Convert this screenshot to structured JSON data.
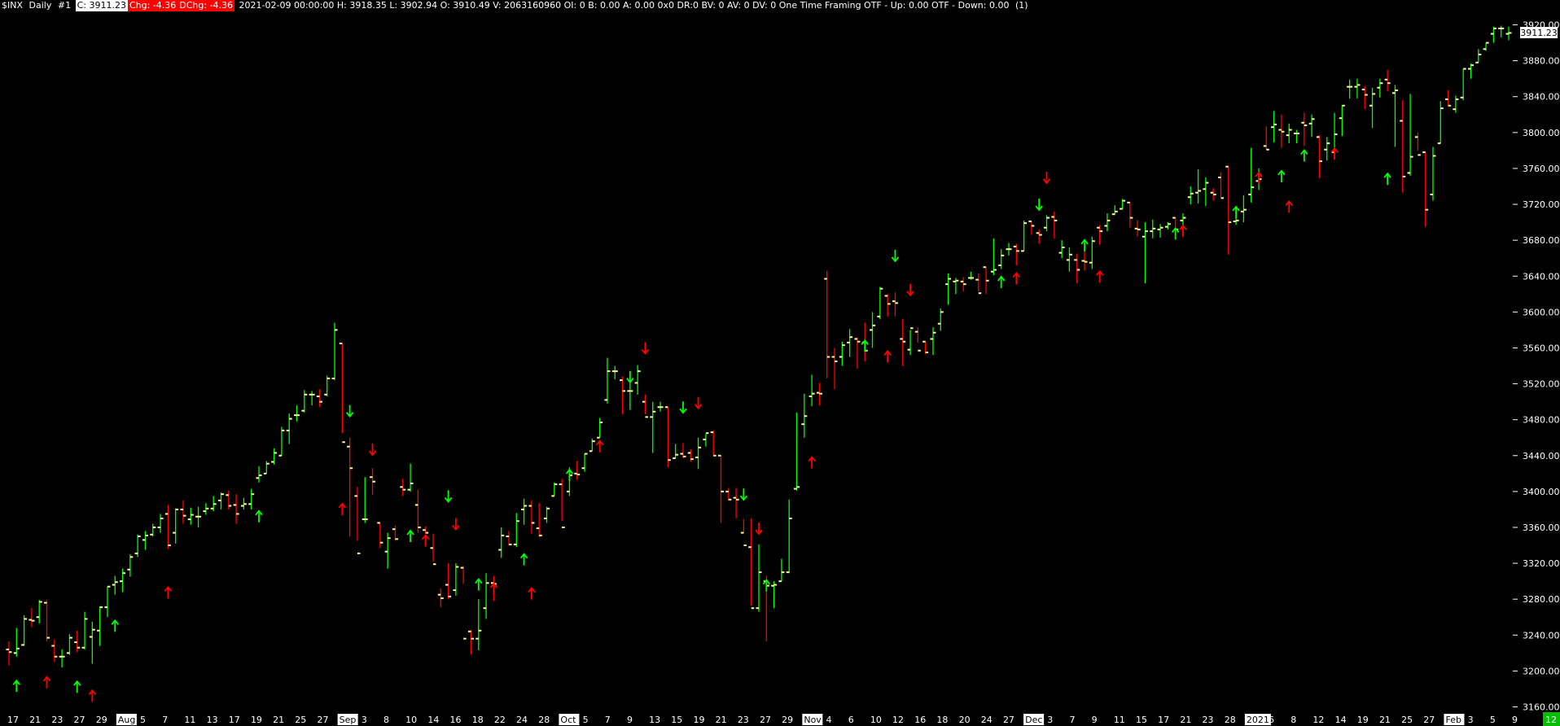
{
  "header": {
    "symbol": "$INX",
    "period": "Daily",
    "chart_no": "#1",
    "close": "C: 3911.23",
    "chg": "Chg: -4.36",
    "dchg": "DChg: -4.36",
    "ohlc": "2021-02-09 00:00:00 H: 3918.35 L: 3902.94 O: 3910.49 V: 2063160960 OI: 0 B: 0.00 A: 0.00 0x0 DR:0 BV: 0 AV: 0 DV: 0 One Time Framing  OTF - Up: 0.00  OTF - Down: 0.00",
    "count": "(1)"
  },
  "price_label": "3911.23",
  "corner_label": "12",
  "colors": {
    "up": "#00ff00",
    "down": "#ff0000",
    "oc_tick": "#ffff99",
    "background": "#000000",
    "text": "#ffffff"
  },
  "chart_data": {
    "type": "ohlc",
    "ylim": [
      3155,
      3935
    ],
    "y_ticks": [
      "3160.00",
      "3200.00",
      "3240.00",
      "3280.00",
      "3320.00",
      "3360.00",
      "3400.00",
      "3440.00",
      "3480.00",
      "3520.00",
      "3560.00",
      "3600.00",
      "3640.00",
      "3680.00",
      "3720.00",
      "3760.00",
      "3800.00",
      "3840.00",
      "3880.00",
      "3920.00"
    ],
    "x_ticks": [
      "17",
      "21",
      "23",
      "27",
      "29",
      "Aug",
      "5",
      "7",
      "11",
      "13",
      "17",
      "19",
      "21",
      "25",
      "27",
      "Sep",
      "3",
      "8",
      "10",
      "14",
      "16",
      "18",
      "22",
      "24",
      "28",
      "Oct",
      "5",
      "7",
      "9",
      "13",
      "15",
      "19",
      "21",
      "23",
      "27",
      "29",
      "Nov",
      "4",
      "6",
      "10",
      "12",
      "16",
      "18",
      "20",
      "24",
      "27",
      "Dec",
      "3",
      "7",
      "9",
      "11",
      "15",
      "17",
      "21",
      "23",
      "28",
      "2021",
      "6",
      "8",
      "12",
      "14",
      "19",
      "21",
      "25",
      "27",
      "Feb",
      "3",
      "5",
      "9"
    ],
    "boxed_x_ticks": [
      "Aug",
      "Sep",
      "Oct",
      "Nov",
      "Dec",
      "2021",
      "Feb"
    ],
    "bars": [
      [
        3224,
        3233,
        3206,
        3221
      ],
      [
        3220,
        3248,
        3216,
        3225
      ],
      [
        3229,
        3262,
        3228,
        3258
      ],
      [
        3257,
        3270,
        3249,
        3256
      ],
      [
        3260,
        3279,
        3253,
        3277
      ],
      [
        3276,
        3279,
        3233,
        3237
      ],
      [
        3228,
        3235,
        3210,
        3216
      ],
      [
        3216,
        3224,
        3204,
        3216
      ],
      [
        3220,
        3241,
        3218,
        3237
      ],
      [
        3232,
        3245,
        3221,
        3226
      ],
      [
        3226,
        3266,
        3224,
        3258
      ],
      [
        3238,
        3255,
        3208,
        3246
      ],
      [
        3245,
        3272,
        3228,
        3271
      ],
      [
        3271,
        3294,
        3260,
        3294
      ],
      [
        3296,
        3306,
        3285,
        3299
      ],
      [
        3300,
        3314,
        3288,
        3309
      ],
      [
        3313,
        3330,
        3305,
        3327
      ],
      [
        3331,
        3352,
        3327,
        3350
      ],
      [
        3346,
        3356,
        3335,
        3351
      ],
      [
        3352,
        3364,
        3350,
        3360
      ],
      [
        3360,
        3375,
        3354,
        3370
      ],
      [
        3375,
        3385,
        3336,
        3340
      ],
      [
        3354,
        3381,
        3342,
        3380
      ],
      [
        3380,
        3390,
        3364,
        3373
      ],
      [
        3369,
        3382,
        3363,
        3374
      ],
      [
        3372,
        3383,
        3360,
        3372
      ],
      [
        3378,
        3387,
        3374,
        3381
      ],
      [
        3381,
        3395,
        3378,
        3386
      ],
      [
        3390,
        3399,
        3380,
        3397
      ],
      [
        3396,
        3401,
        3380,
        3384
      ],
      [
        3385,
        3397,
        3364,
        3375
      ],
      [
        3384,
        3393,
        3380,
        3386
      ],
      [
        3386,
        3403,
        3380,
        3397
      ],
      [
        3415,
        3428,
        3410,
        3418
      ],
      [
        3420,
        3434,
        3420,
        3431
      ],
      [
        3433,
        3448,
        3430,
        3443
      ],
      [
        3440,
        3472,
        3440,
        3468
      ],
      [
        3468,
        3487,
        3453,
        3481
      ],
      [
        3485,
        3496,
        3478,
        3485
      ],
      [
        3490,
        3513,
        3488,
        3508
      ],
      [
        3508,
        3512,
        3496,
        3508
      ],
      [
        3506,
        3514,
        3494,
        3500
      ],
      [
        3508,
        3529,
        3506,
        3526
      ],
      [
        3526,
        3588,
        3524,
        3580
      ],
      [
        3565,
        3565,
        3465,
        3455
      ],
      [
        3450,
        3460,
        3350,
        3426
      ],
      [
        3395,
        3405,
        3345,
        3331
      ],
      [
        3369,
        3416,
        3365,
        3369
      ],
      [
        3416,
        3426,
        3396,
        3411
      ],
      [
        3365,
        3365,
        3337,
        3343
      ],
      [
        3333,
        3354,
        3314,
        3348
      ],
      [
        3358,
        3362,
        3345,
        3347
      ],
      [
        3405,
        3414,
        3395,
        3402
      ],
      [
        3402,
        3431,
        3400,
        3409
      ],
      [
        3385,
        3402,
        3354,
        3360
      ],
      [
        3357,
        3361,
        3353,
        3354
      ],
      [
        3337,
        3353,
        3322,
        3319
      ],
      [
        3285,
        3292,
        3271,
        3281
      ],
      [
        3296,
        3320,
        3280,
        3283
      ],
      [
        3290,
        3320,
        3284,
        3316
      ],
      [
        3315,
        3317,
        3297,
        3236
      ],
      [
        3244,
        3246,
        3218,
        3236
      ],
      [
        3236,
        3280,
        3223,
        3245
      ],
      [
        3270,
        3309,
        3258,
        3298
      ],
      [
        3298,
        3306,
        3278,
        3297
      ],
      [
        3335,
        3360,
        3326,
        3351
      ],
      [
        3350,
        3356,
        3340,
        3341
      ],
      [
        3341,
        3376,
        3338,
        3367
      ],
      [
        3380,
        3392,
        3363,
        3384
      ],
      [
        3384,
        3390,
        3353,
        3365
      ],
      [
        3359,
        3387,
        3349,
        3351
      ],
      [
        3370,
        3383,
        3365,
        3381
      ],
      [
        3395,
        3410,
        3395,
        3408
      ],
      [
        3408,
        3414,
        3367,
        3360
      ],
      [
        3400,
        3427,
        3395,
        3418
      ],
      [
        3420,
        3434,
        3413,
        3419
      ],
      [
        3426,
        3442,
        3422,
        3442
      ],
      [
        3445,
        3459,
        3445,
        3456
      ],
      [
        3460,
        3482,
        3460,
        3477
      ],
      [
        3502,
        3549,
        3498,
        3534
      ],
      [
        3534,
        3540,
        3525,
        3534
      ],
      [
        3524,
        3528,
        3486,
        3512
      ],
      [
        3512,
        3525,
        3491,
        3512
      ],
      [
        3521,
        3541,
        3508,
        3534
      ],
      [
        3500,
        3508,
        3486,
        3483
      ],
      [
        3483,
        3500,
        3443,
        3489
      ],
      [
        3494,
        3500,
        3489,
        3494
      ],
      [
        3494,
        3494,
        3427,
        3435
      ],
      [
        3437,
        3453,
        3437,
        3441
      ],
      [
        3442,
        3454,
        3437,
        3439
      ],
      [
        3443,
        3447,
        3433,
        3436
      ],
      [
        3438,
        3460,
        3425,
        3449
      ],
      [
        3458,
        3464,
        3450,
        3465
      ],
      [
        3466,
        3468,
        3440,
        3440
      ],
      [
        3440,
        3440,
        3365,
        3400
      ],
      [
        3400,
        3404,
        3390,
        3391
      ],
      [
        3393,
        3404,
        3370,
        3391
      ],
      [
        3354,
        3369,
        3354,
        3340
      ],
      [
        3338,
        3370,
        3273,
        3270
      ],
      [
        3270,
        3341,
        3266,
        3310
      ],
      [
        3300,
        3306,
        3233,
        3295
      ],
      [
        3295,
        3300,
        3270,
        3296
      ],
      [
        3300,
        3325,
        3300,
        3310
      ],
      [
        3310,
        3391,
        3309,
        3370
      ],
      [
        3403,
        3488,
        3401,
        3405
      ],
      [
        3475,
        3509,
        3460,
        3484
      ],
      [
        3506,
        3530,
        3495,
        3509
      ],
      [
        3510,
        3521,
        3496,
        3509
      ],
      [
        3637,
        3646,
        3526,
        3550
      ],
      [
        3550,
        3560,
        3514,
        3545
      ],
      [
        3550,
        3567,
        3540,
        3563
      ],
      [
        3566,
        3581,
        3550,
        3572
      ],
      [
        3570,
        3572,
        3537,
        3567
      ],
      [
        3566,
        3588,
        3545,
        3557
      ],
      [
        3580,
        3600,
        3560,
        3585
      ],
      [
        3595,
        3628,
        3592,
        3626
      ],
      [
        3618,
        3620,
        3595,
        3609
      ],
      [
        3612,
        3622,
        3595,
        3610
      ],
      [
        3570,
        3592,
        3540,
        3567
      ],
      [
        3558,
        3580,
        3552,
        3582
      ],
      [
        3578,
        3583,
        3566,
        3557
      ],
      [
        3567,
        3567,
        3553,
        3555
      ],
      [
        3570,
        3583,
        3552,
        3577
      ],
      [
        3587,
        3604,
        3579,
        3600
      ],
      [
        3631,
        3643,
        3608,
        3637
      ],
      [
        3634,
        3638,
        3620,
        3635
      ],
      [
        3634,
        3639,
        3623,
        3631
      ],
      [
        3638,
        3645,
        3636,
        3638
      ],
      [
        3636,
        3643,
        3623,
        3621
      ],
      [
        3650,
        3650,
        3620,
        3635
      ],
      [
        3645,
        3682,
        3641,
        3647
      ],
      [
        3652,
        3670,
        3648,
        3663
      ],
      [
        3670,
        3677,
        3663,
        3670
      ],
      [
        3673,
        3676,
        3652,
        3668
      ],
      [
        3668,
        3702,
        3668,
        3699
      ],
      [
        3701,
        3701,
        3686,
        3696
      ],
      [
        3688,
        3692,
        3676,
        3686
      ],
      [
        3694,
        3708,
        3690,
        3705
      ],
      [
        3706,
        3712,
        3682,
        3702
      ],
      [
        3666,
        3680,
        3660,
        3672
      ],
      [
        3658,
        3672,
        3645,
        3664
      ],
      [
        3658,
        3665,
        3632,
        3647
      ],
      [
        3657,
        3669,
        3646,
        3656
      ],
      [
        3655,
        3684,
        3648,
        3679
      ],
      [
        3694,
        3697,
        3675,
        3690
      ],
      [
        3696,
        3710,
        3690,
        3702
      ],
      [
        3709,
        3719,
        3708,
        3712
      ],
      [
        3715,
        3726,
        3714,
        3724
      ],
      [
        3722,
        3722,
        3694,
        3705
      ],
      [
        3693,
        3702,
        3684,
        3692
      ],
      [
        3684,
        3700,
        3632,
        3690
      ],
      [
        3690,
        3703,
        3682,
        3693
      ],
      [
        3692,
        3698,
        3683,
        3694
      ],
      [
        3695,
        3700,
        3692,
        3698
      ],
      [
        3705,
        3705,
        3694,
        3692
      ],
      [
        3702,
        3710,
        3691,
        3705
      ],
      [
        3728,
        3740,
        3720,
        3732
      ],
      [
        3733,
        3759,
        3721,
        3735
      ],
      [
        3737,
        3750,
        3718,
        3744
      ],
      [
        3733,
        3738,
        3724,
        3731
      ],
      [
        3750,
        3756,
        3728,
        3727
      ],
      [
        3762,
        3762,
        3664,
        3700
      ],
      [
        3701,
        3707,
        3697,
        3702
      ],
      [
        3712,
        3730,
        3700,
        3714
      ],
      [
        3731,
        3783,
        3722,
        3739
      ],
      [
        3746,
        3760,
        3736,
        3748
      ],
      [
        3785,
        3807,
        3781,
        3781
      ],
      [
        3806,
        3824,
        3789,
        3809
      ],
      [
        3803,
        3820,
        3783,
        3801
      ],
      [
        3797,
        3810,
        3788,
        3803
      ],
      [
        3799,
        3803,
        3788,
        3799
      ],
      [
        3811,
        3822,
        3785,
        3808
      ],
      [
        3810,
        3820,
        3795,
        3815
      ],
      [
        3795,
        3797,
        3749,
        3768
      ],
      [
        3781,
        3795,
        3769,
        3788
      ],
      [
        3778,
        3822,
        3770,
        3798
      ],
      [
        3816,
        3830,
        3796,
        3830
      ],
      [
        3851,
        3859,
        3838,
        3851
      ],
      [
        3851,
        3860,
        3838,
        3853
      ],
      [
        3848,
        3852,
        3826,
        3842
      ],
      [
        3830,
        3850,
        3805,
        3843
      ],
      [
        3850,
        3860,
        3839,
        3855
      ],
      [
        3859,
        3870,
        3846,
        3855
      ],
      [
        3844,
        3853,
        3784,
        3847
      ],
      [
        3813,
        3836,
        3733,
        3751
      ],
      [
        3755,
        3843,
        3752,
        3773
      ],
      [
        3795,
        3800,
        3780,
        3775
      ],
      [
        3778,
        3779,
        3695,
        3714
      ],
      [
        3731,
        3784,
        3724,
        3774
      ],
      [
        3788,
        3835,
        3788,
        3827
      ],
      [
        3837,
        3847,
        3830,
        3830
      ],
      [
        3826,
        3841,
        3822,
        3837
      ],
      [
        3839,
        3871,
        3836,
        3871
      ],
      [
        3871,
        3877,
        3860,
        3875
      ],
      [
        3878,
        3893,
        3878,
        3887
      ],
      [
        3893,
        3900,
        3891,
        3900
      ],
      [
        3910,
        3918,
        3900,
        3916
      ],
      [
        3916,
        3919,
        3906,
        3916
      ],
      [
        3910,
        3918,
        3903,
        3911
      ]
    ],
    "arrows": [
      [
        "up",
        "green",
        1,
        3183
      ],
      [
        "up",
        "red",
        5,
        3187
      ],
      [
        "up",
        "green",
        9,
        3182
      ],
      [
        "up",
        "red",
        11,
        3172
      ],
      [
        "up",
        "green",
        14,
        3250
      ],
      [
        "up",
        "red",
        21,
        3287
      ],
      [
        "up",
        "green",
        33,
        3372
      ],
      [
        "down",
        "green",
        45,
        3490
      ],
      [
        "up",
        "red",
        44,
        3380
      ],
      [
        "down",
        "red",
        48,
        3447
      ],
      [
        "up",
        "green",
        53,
        3350
      ],
      [
        "up",
        "red",
        55,
        3345
      ],
      [
        "down",
        "green",
        58,
        3395
      ],
      [
        "down",
        "red",
        59,
        3364
      ],
      [
        "up",
        "green",
        62,
        3296
      ],
      [
        "up",
        "red",
        64,
        3291
      ],
      [
        "up",
        "green",
        68,
        3324
      ],
      [
        "up",
        "red",
        69,
        3286
      ],
      [
        "up",
        "green",
        74,
        3418
      ],
      [
        "up",
        "red",
        78,
        3450
      ],
      [
        "down",
        "green",
        82,
        3528
      ],
      [
        "down",
        "red",
        84,
        3560
      ],
      [
        "down",
        "green",
        89,
        3494
      ],
      [
        "down",
        "red",
        91,
        3499
      ],
      [
        "down",
        "green",
        97,
        3397
      ],
      [
        "down",
        "red",
        99,
        3359
      ],
      [
        "up",
        "green",
        100,
        3295
      ],
      [
        "up",
        "red",
        106,
        3432
      ],
      [
        "down",
        "green",
        117,
        3663
      ],
      [
        "down",
        "red",
        119,
        3625
      ],
      [
        "up",
        "green",
        113,
        3562
      ],
      [
        "up",
        "red",
        116,
        3550
      ],
      [
        "up",
        "green",
        131,
        3633
      ],
      [
        "up",
        "red",
        133,
        3637
      ],
      [
        "down",
        "red",
        137,
        3750
      ],
      [
        "down",
        "green",
        136,
        3720
      ],
      [
        "up",
        "green",
        142,
        3674
      ],
      [
        "up",
        "red",
        144,
        3639
      ],
      [
        "up",
        "green",
        154,
        3687
      ],
      [
        "up",
        "red",
        155,
        3690
      ],
      [
        "up",
        "green",
        162,
        3711
      ],
      [
        "up",
        "red",
        165,
        3749
      ],
      [
        "up",
        "green",
        168,
        3751
      ],
      [
        "up",
        "red",
        169,
        3717
      ],
      [
        "up",
        "green",
        171,
        3774
      ],
      [
        "up",
        "red",
        175,
        3776
      ],
      [
        "up",
        "green",
        182,
        3748
      ]
    ]
  }
}
